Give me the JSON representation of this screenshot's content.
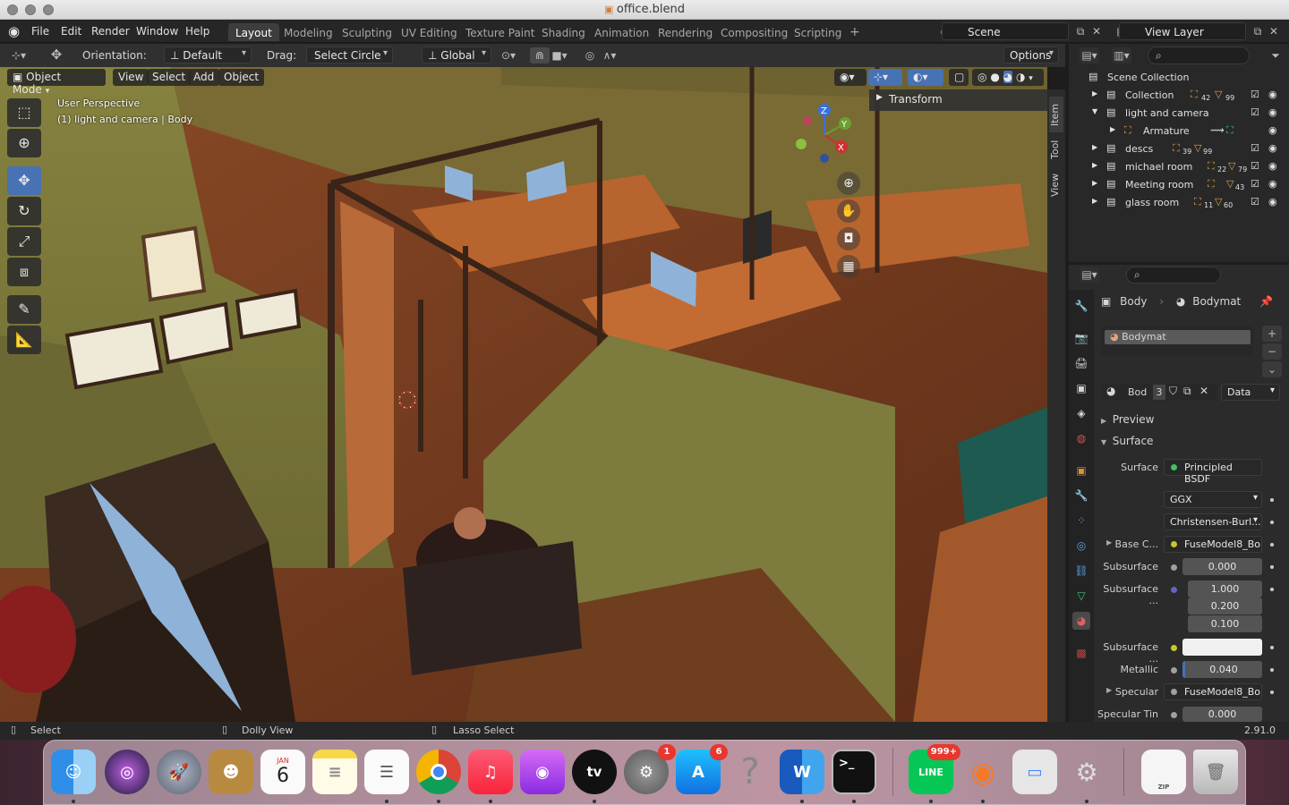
{
  "window": {
    "title": "office.blend"
  },
  "menu": [
    "File",
    "Edit",
    "Render",
    "Window",
    "Help"
  ],
  "workspaces": [
    "Layout",
    "Modeling",
    "Sculpting",
    "UV Editing",
    "Texture Paint",
    "Shading",
    "Animation",
    "Rendering",
    "Compositing",
    "Scripting"
  ],
  "scene": {
    "label": "Scene",
    "view_layer": "View Layer"
  },
  "tool_header": {
    "orientation_label": "Orientation:",
    "orientation_value": "Default",
    "drag_label": "Drag:",
    "drag_value": "Select Circle",
    "transform_orientation": "Global",
    "options": "Options"
  },
  "viewport_header": {
    "mode": "Object Mode",
    "menus": [
      "View",
      "Select",
      "Add",
      "Object"
    ]
  },
  "viewport": {
    "perspective": "User Perspective",
    "context": "(1) light and camera | Body",
    "transform_panel": "Transform"
  },
  "side_tabs": [
    "Item",
    "Tool",
    "View"
  ],
  "gizmo": {
    "z": "Z",
    "y": "Y",
    "x": "X"
  },
  "outliner": {
    "root": "Scene Collection",
    "rows": [
      {
        "name": "Collection",
        "badge1": "42",
        "badge2": "99"
      },
      {
        "name": "light and camera",
        "badge1": "",
        "badge2": ""
      },
      {
        "name": "Armature",
        "badge1": "",
        "badge2": ""
      },
      {
        "name": "descs",
        "badge1": "39",
        "badge2": "99"
      },
      {
        "name": "michael room",
        "badge1": "22",
        "badge2": "79"
      },
      {
        "name": "Meeting room",
        "badge1": "",
        "badge2": "43"
      },
      {
        "name": "glass room",
        "badge1": "11",
        "badge2": "60"
      }
    ]
  },
  "properties": {
    "object_name": "Body",
    "material_name": "Bodymat",
    "slot_name": "Bodymat",
    "datablock_short": "Bod",
    "user_count": "3",
    "link": "Data",
    "sections": {
      "preview": "Preview",
      "surface": "Surface"
    },
    "fields": [
      {
        "label": "Surface",
        "value": "Principled BSDF"
      },
      {
        "label": "",
        "value": "GGX"
      },
      {
        "label": "",
        "value": "Christensen-Burl..."
      },
      {
        "label": "Base C...",
        "value": "FuseModel8_Bo..."
      },
      {
        "label": "Subsurface",
        "value": "0.000"
      },
      {
        "label": "Subsurface ...",
        "value": "1.000"
      },
      {
        "label": "",
        "value": "0.200"
      },
      {
        "label": "",
        "value": "0.100"
      },
      {
        "label": "Subsurface ...",
        "value": ""
      },
      {
        "label": "Metallic",
        "value": "0.040"
      },
      {
        "label": "Specular",
        "value": "FuseModel8_Bo..."
      },
      {
        "label": "Specular Tin",
        "value": "0.000"
      }
    ]
  },
  "statusbar": {
    "select": "Select",
    "dolly": "Dolly View",
    "lasso": "Lasso Select",
    "version": "2.91.0"
  },
  "dock": {
    "calendar_month": "JAN",
    "calendar_day": "6",
    "badges": {
      "settings": "1",
      "appstore": "6",
      "line": "999+"
    },
    "apps": [
      "Finder",
      "Siri",
      "Launchpad",
      "Contacts",
      "Calendar",
      "Notes",
      "Reminders",
      "Chrome",
      "Music",
      "Podcasts",
      "TV",
      "System Preferences",
      "App Store",
      "Help",
      "Word",
      "Terminal",
      "LINE",
      "Blender",
      "Screen Sharing",
      "Automator",
      "Archive",
      "Trash"
    ],
    "labels": {
      "tv": "tv",
      "word": "W",
      "terminal": ">_",
      "line": "LINE",
      "zip": "ZIP"
    }
  },
  "colors": {
    "accent": "#4772b3",
    "header": "#262626",
    "panel": "#2b2b2b",
    "wall": "#7a7a3a",
    "floor": "#7a3a1f"
  }
}
